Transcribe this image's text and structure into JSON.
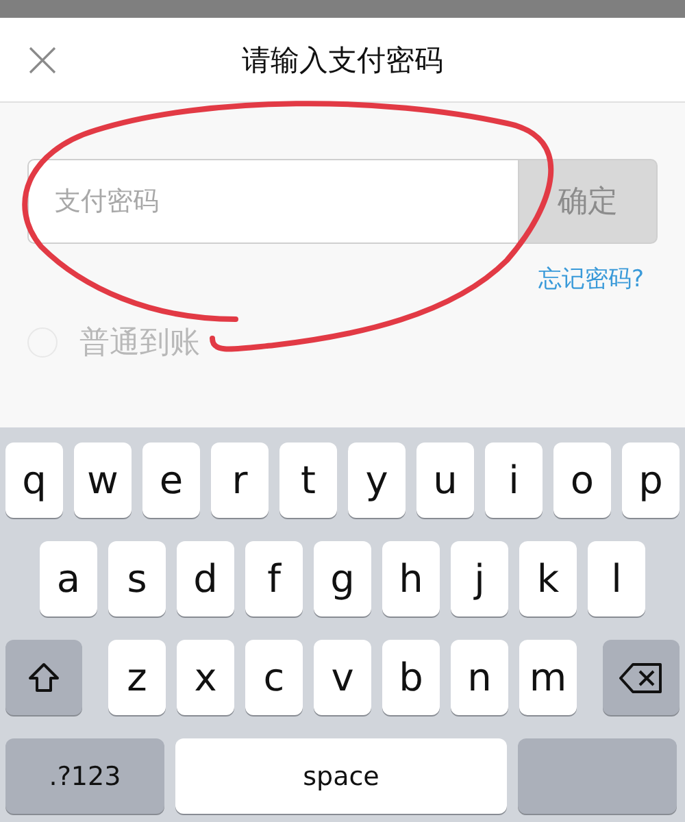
{
  "background": {
    "option": {
      "label": "普通到账",
      "selected": false
    }
  },
  "dialog": {
    "title": "请输入支付密码",
    "password_field": {
      "placeholder": "支付密码"
    },
    "confirm_button": {
      "label": "确定",
      "disabled": true
    },
    "forgot_link": "忘记密码?"
  },
  "keyboard": {
    "rows": [
      {
        "keys": [
          {
            "kind": "letter",
            "label": "q"
          },
          {
            "kind": "letter",
            "label": "w"
          },
          {
            "kind": "letter",
            "label": "e"
          },
          {
            "kind": "letter",
            "label": "r"
          },
          {
            "kind": "letter",
            "label": "t"
          },
          {
            "kind": "letter",
            "label": "y"
          },
          {
            "kind": "letter",
            "label": "u"
          },
          {
            "kind": "letter",
            "label": "i"
          },
          {
            "kind": "letter",
            "label": "o"
          },
          {
            "kind": "letter",
            "label": "p"
          }
        ]
      },
      {
        "keys": [
          {
            "kind": "letter",
            "label": "a"
          },
          {
            "kind": "letter",
            "label": "s"
          },
          {
            "kind": "letter",
            "label": "d"
          },
          {
            "kind": "letter",
            "label": "f"
          },
          {
            "kind": "letter",
            "label": "g"
          },
          {
            "kind": "letter",
            "label": "h"
          },
          {
            "kind": "letter",
            "label": "j"
          },
          {
            "kind": "letter",
            "label": "k"
          },
          {
            "kind": "letter",
            "label": "l"
          }
        ]
      },
      {
        "keys": [
          {
            "kind": "shift"
          },
          {
            "kind": "letter",
            "label": "z"
          },
          {
            "kind": "letter",
            "label": "x"
          },
          {
            "kind": "letter",
            "label": "c"
          },
          {
            "kind": "letter",
            "label": "v"
          },
          {
            "kind": "letter",
            "label": "b"
          },
          {
            "kind": "letter",
            "label": "n"
          },
          {
            "kind": "letter",
            "label": "m"
          },
          {
            "kind": "delete"
          }
        ]
      },
      {
        "keys": [
          {
            "kind": "mode",
            "label": ".?123"
          },
          {
            "kind": "space",
            "label": "space"
          },
          {
            "kind": "return"
          }
        ]
      }
    ]
  }
}
